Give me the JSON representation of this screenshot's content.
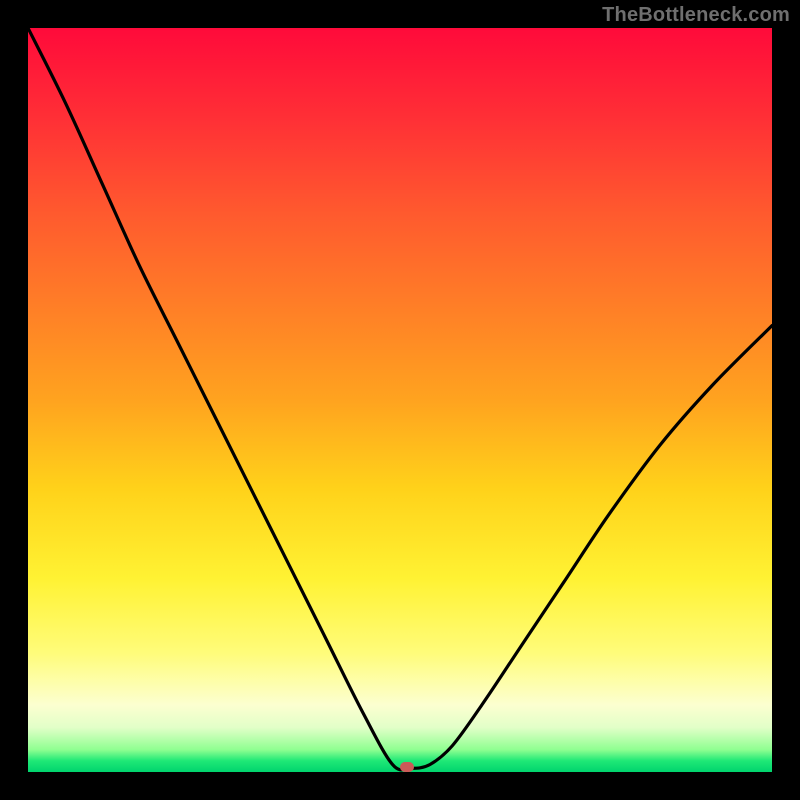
{
  "watermark": "TheBottleneck.com",
  "chart_data": {
    "type": "line",
    "title": "",
    "xlabel": "",
    "ylabel": "",
    "xlim": [
      0,
      1
    ],
    "ylim": [
      0,
      1
    ],
    "background_gradient": {
      "orientation": "vertical",
      "stops": [
        {
          "pos": 0.0,
          "color": "#ff0a3a"
        },
        {
          "pos": 0.25,
          "color": "#ff5a2e"
        },
        {
          "pos": 0.5,
          "color": "#ffa31f"
        },
        {
          "pos": 0.74,
          "color": "#fff233"
        },
        {
          "pos": 0.91,
          "color": "#fcffd0"
        },
        {
          "pos": 1.0,
          "color": "#00d46e"
        }
      ]
    },
    "series": [
      {
        "name": "bottleneck-curve",
        "color": "#000000",
        "x": [
          0.0,
          0.05,
          0.1,
          0.15,
          0.2,
          0.25,
          0.3,
          0.35,
          0.4,
          0.45,
          0.49,
          0.515,
          0.54,
          0.57,
          0.61,
          0.66,
          0.72,
          0.78,
          0.85,
          0.92,
          1.0
        ],
        "y": [
          1.0,
          0.9,
          0.79,
          0.68,
          0.58,
          0.48,
          0.38,
          0.28,
          0.18,
          0.08,
          0.01,
          0.005,
          0.01,
          0.035,
          0.09,
          0.165,
          0.255,
          0.345,
          0.44,
          0.52,
          0.6
        ]
      }
    ],
    "marker": {
      "name": "optimal-point",
      "x": 0.51,
      "y": 0.007,
      "color": "#cc5a58"
    }
  }
}
